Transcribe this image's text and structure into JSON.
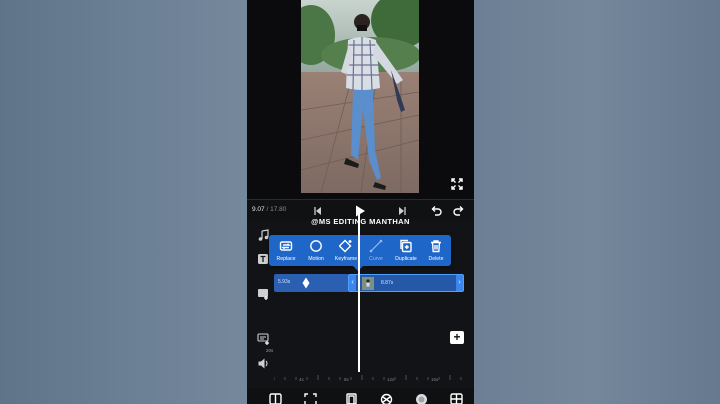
{
  "app": {
    "accent": "#1f66c9",
    "selection": "#4ea0ff"
  },
  "preview": {
    "expand_icon": "fullscreen-expand-icon"
  },
  "transport": {
    "current_time": "9.07",
    "total_time": "17.80",
    "separator": " / "
  },
  "watermark": "@MS EDITING MANTHAN",
  "context_menu": {
    "items": [
      {
        "label": "Replace",
        "icon": "replace-icon"
      },
      {
        "label": "Motion",
        "icon": "motion-icon"
      },
      {
        "label": "Keyframe",
        "icon": "keyframe-icon"
      },
      {
        "label": "Curve",
        "icon": "curve-icon"
      },
      {
        "label": "Duplicate",
        "icon": "duplicate-icon"
      },
      {
        "label": "Delete",
        "icon": "delete-icon"
      }
    ]
  },
  "timeline": {
    "clip_left_duration": "5.93s",
    "clip_right_duration": "8.87s",
    "ruler": [
      "4s",
      "8s",
      "12s",
      "16s"
    ],
    "track_label": "20s"
  }
}
